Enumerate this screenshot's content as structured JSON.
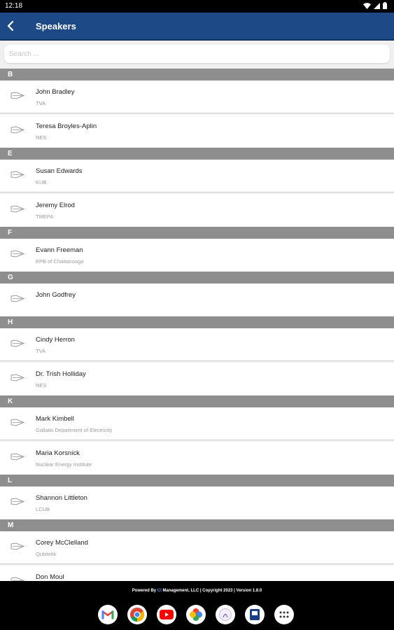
{
  "status_bar": {
    "time": "12:18"
  },
  "app_bar": {
    "title": "Speakers"
  },
  "search": {
    "placeholder": "Search ..."
  },
  "sections": [
    {
      "letter": "B",
      "speakers": [
        {
          "name": "John Bradley",
          "org": "TVA"
        },
        {
          "name": "Teresa  Broyles-Aplin",
          "org": "NES"
        }
      ]
    },
    {
      "letter": "E",
      "speakers": [
        {
          "name": "Susan Edwards",
          "org": "KUB"
        },
        {
          "name": "Jeremy Elrod",
          "org": "TMEPA"
        }
      ]
    },
    {
      "letter": "F",
      "speakers": [
        {
          "name": "Evann Freeman",
          "org": "EPB of Chattanooga"
        }
      ]
    },
    {
      "letter": "G",
      "speakers": [
        {
          "name": "John Godfrey",
          "org": ""
        }
      ]
    },
    {
      "letter": "H",
      "speakers": [
        {
          "name": "Cindy Herron",
          "org": "TVA"
        },
        {
          "name": "Dr. Trish Holliday",
          "org": "NES"
        }
      ]
    },
    {
      "letter": "K",
      "speakers": [
        {
          "name": "Mark Kimbell",
          "org": "Gallatin Department of Electricity"
        },
        {
          "name": "Maria Korsnick",
          "org": "Nuclear Energy Institute"
        }
      ]
    },
    {
      "letter": "L",
      "speakers": [
        {
          "name": "Shannon Littleton",
          "org": "LCUB"
        }
      ]
    },
    {
      "letter": "M",
      "speakers": [
        {
          "name": "Corey McClelland",
          "org": "Qubitekk"
        },
        {
          "name": "Don Moul",
          "org": ""
        }
      ]
    }
  ],
  "footer": {
    "prefix": "Powered By",
    "brand": "CI",
    "text": "Management, LLC | Copyright 2023 | Version 1.8.0"
  },
  "dock_apps": [
    "gmail-icon",
    "chrome-icon",
    "youtube-icon",
    "photos-icon",
    "app-icon-circle",
    "app-icon-notebook",
    "app-drawer-icon"
  ]
}
